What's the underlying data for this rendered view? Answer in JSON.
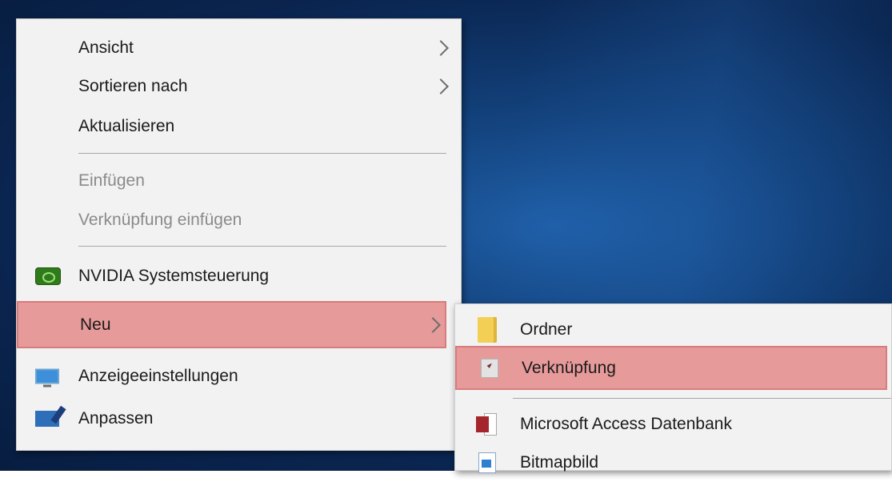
{
  "context_menu": {
    "items": [
      {
        "label": "Ansicht",
        "has_submenu": true,
        "enabled": true
      },
      {
        "label": "Sortieren nach",
        "has_submenu": true,
        "enabled": true
      },
      {
        "label": "Aktualisieren",
        "has_submenu": false,
        "enabled": true
      },
      {
        "label": "Einfügen",
        "has_submenu": false,
        "enabled": false
      },
      {
        "label": "Verknüpfung einfügen",
        "has_submenu": false,
        "enabled": false
      },
      {
        "label": "NVIDIA Systemsteuerung",
        "icon": "nvidia-icon",
        "has_submenu": false,
        "enabled": true
      },
      {
        "label": "Neu",
        "has_submenu": true,
        "enabled": true,
        "highlighted": true
      },
      {
        "label": "Anzeigeeinstellungen",
        "icon": "display-settings-icon",
        "has_submenu": false,
        "enabled": true
      },
      {
        "label": "Anpassen",
        "icon": "personalize-icon",
        "has_submenu": false,
        "enabled": true
      }
    ]
  },
  "submenu_neu": {
    "items": [
      {
        "label": "Ordner",
        "icon": "folder-icon"
      },
      {
        "label": "Verknüpfung",
        "icon": "shortcut-icon",
        "highlighted": true
      },
      {
        "label": "Microsoft Access Datenbank",
        "icon": "access-icon"
      },
      {
        "label": "Bitmapbild",
        "icon": "bitmap-icon"
      }
    ]
  },
  "colors": {
    "menu_background": "#f2f2f2",
    "highlight": "#e79a9a",
    "desktop": "#123f78"
  }
}
